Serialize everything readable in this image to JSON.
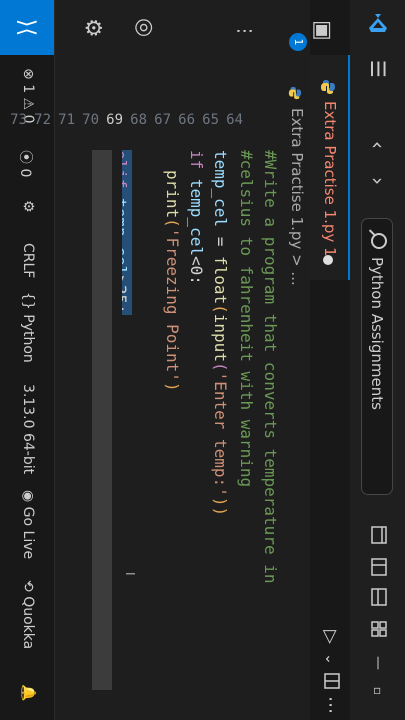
{
  "title_bar": {
    "search_text": "Python Assignments"
  },
  "tab": {
    "label": "Extra Practise 1.py 1"
  },
  "breadcrumb": {
    "text": "Extra Practise 1.py > ..."
  },
  "line_numbers": [
    "73",
    "72",
    "71",
    "70",
    "69",
    "68",
    "67",
    "66",
    "65",
    "64"
  ],
  "code": {
    "line64": "#Write a program that converts temperature in",
    "line65": "#celsius to fahrenheit with warning",
    "line66_var": "temp_cel",
    "line66_rest": " = ",
    "line66_fn1": "float",
    "line66_p1": "(",
    "line66_fn2": "input",
    "line66_p2": "(",
    "line66_str": "'Enter temp:'",
    "line66_p3": "))",
    "line67_kw": "if",
    "line67_var": " temp_cel",
    "line67_rest": "<0:",
    "line68_fn": "print",
    "line68_p1": "(",
    "line68_str": "'Freezing Point'",
    "line68_p2": ")",
    "line69_kw": "elif",
    "line69_var": " temp_cel",
    "line69_rest": ">35:"
  },
  "status": {
    "errors": "1",
    "warnings": "0",
    "ports": "0",
    "line_ending": "CRLF",
    "language": "Python",
    "interpreter": "3.13.0 64-bit",
    "go_live": "Go Live",
    "quokka": "Quokka",
    "language_icon": "{}"
  },
  "notifications": {
    "count": "1"
  },
  "colors": {
    "accent": "#0078d4",
    "tab_error_text": "#f48771",
    "comment": "#6a9955",
    "keyword": "#c586c0",
    "variable": "#9cdcfe",
    "string": "#ce9178"
  }
}
